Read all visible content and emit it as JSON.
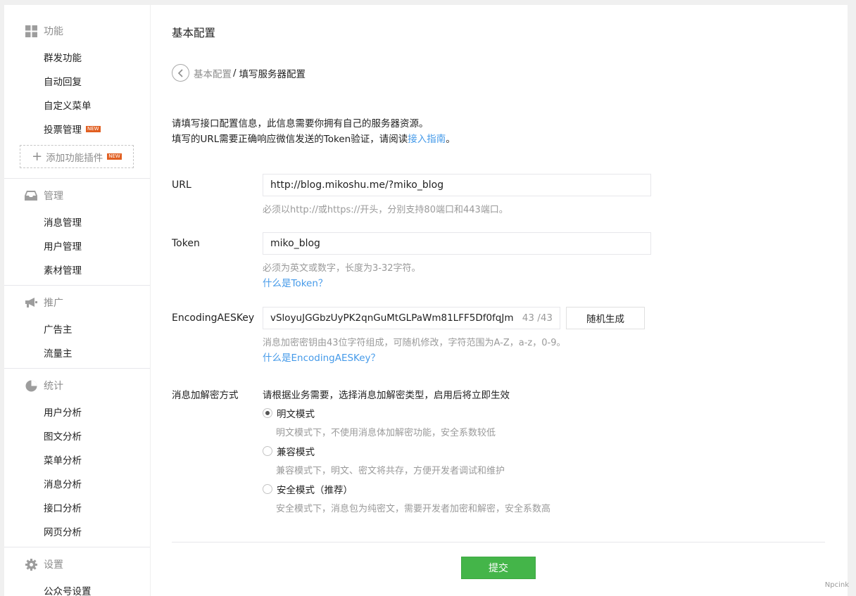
{
  "sidebar": {
    "features": {
      "title": "功能",
      "items": [
        "群发功能",
        "自动回复",
        "自定义菜单",
        "投票管理"
      ],
      "add_plugin": "添加功能插件",
      "new_badge": "NEW"
    },
    "manage": {
      "title": "管理",
      "items": [
        "消息管理",
        "用户管理",
        "素材管理"
      ]
    },
    "promote": {
      "title": "推广",
      "items": [
        "广告主",
        "流量主"
      ]
    },
    "stats": {
      "title": "统计",
      "items": [
        "用户分析",
        "图文分析",
        "菜单分析",
        "消息分析",
        "接口分析",
        "网页分析"
      ]
    },
    "settings": {
      "title": "设置",
      "items": [
        "公众号设置"
      ]
    }
  },
  "main": {
    "title": "基本配置",
    "breadcrumb": {
      "parent": "基本配置",
      "separator": "/",
      "current": "填写服务器配置"
    },
    "desc_line1": "请填写接口配置信息，此信息需要你拥有自己的服务器资源。",
    "desc_line2_prefix": "填写的URL需要正确响应微信发送的Token验证，请阅读",
    "desc_link": "接入指南",
    "desc_line2_suffix": "。",
    "url": {
      "label": "URL",
      "value": "http://blog.mikoshu.me/?miko_blog",
      "hint": "必须以http://或https://开头，分别支持80端口和443端口。"
    },
    "token": {
      "label": "Token",
      "value": "miko_blog",
      "hint": "必须为英文或数字，长度为3-32字符。",
      "link": "什么是Token？"
    },
    "aes": {
      "label": "EncodingAESKey",
      "value": "vSloyuJGGbzUyPK2qnGuMtGLPaWm81LFF5Df0fqJm",
      "counter": "43 /43",
      "generate": "随机生成",
      "hint": "消息加密密钥由43位字符组成，可随机修改，字符范围为A-Z，a-z，0-9。",
      "link": "什么是EncodingAESKey？"
    },
    "encryption": {
      "label": "消息加解密方式",
      "intro": "请根据业务需要，选择消息加解密类型，启用后将立即生效",
      "options": [
        {
          "label": "明文模式",
          "desc": "明文模式下，不使用消息体加解密功能，安全系数较低",
          "checked": true
        },
        {
          "label": "兼容模式",
          "desc": "兼容模式下，明文、密文将共存，方便开发者调试和维护",
          "checked": false
        },
        {
          "label": "安全模式（推荐）",
          "desc": "安全模式下，消息包为纯密文，需要开发者加密和解密，安全系数高",
          "checked": false
        }
      ]
    },
    "submit": "提交"
  },
  "watermark": "Npcink",
  "colors": {
    "accent_green": "#44b549",
    "link_blue": "#459ae9",
    "new_badge": "#e15f21"
  }
}
